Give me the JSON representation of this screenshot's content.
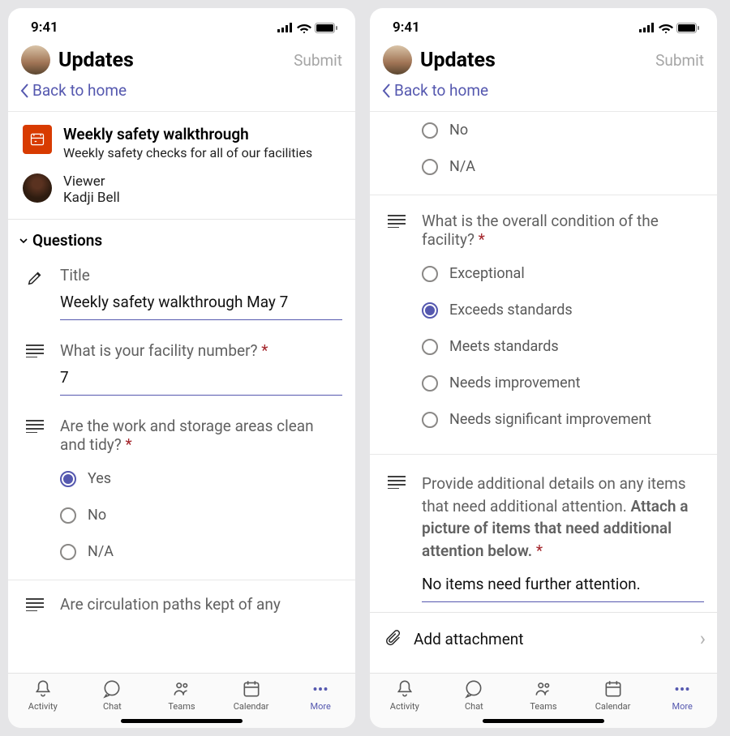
{
  "status": {
    "time": "9:41"
  },
  "header": {
    "title": "Updates",
    "submit": "Submit"
  },
  "back": {
    "label": "Back to home"
  },
  "card": {
    "title": "Weekly safety walkthrough",
    "subtitle": "Weekly safety checks for all of our facilities"
  },
  "viewer": {
    "role": "Viewer",
    "name": "Kadji Bell"
  },
  "sections": {
    "questions": "Questions"
  },
  "q1": {
    "label": "Title",
    "value": "Weekly safety walkthrough May 7"
  },
  "q2": {
    "label": "What is your facility number?",
    "value": "7"
  },
  "q3": {
    "label": "Are the work and storage areas clean and tidy?",
    "options": [
      "Yes",
      "No",
      "N/A"
    ],
    "selected": 0
  },
  "q4": {
    "label": "Are circulation paths kept of any"
  },
  "q5": {
    "prev_options": [
      "No",
      "N/A"
    ]
  },
  "q6": {
    "label": "What is the overall condition of the facility?",
    "options": [
      "Exceptional",
      "Exceeds standards",
      "Meets standards",
      "Needs improvement",
      "Needs significant improvement"
    ],
    "selected": 1
  },
  "q7": {
    "text_plain": "Provide additional details on any items that need additional attention. ",
    "text_bold": "Attach a picture of items that need additional attention below.",
    "value": "No items need further attention."
  },
  "attach": {
    "label": "Add attachment"
  },
  "nav": {
    "items": [
      "Activity",
      "Chat",
      "Teams",
      "Calendar",
      "More"
    ]
  }
}
